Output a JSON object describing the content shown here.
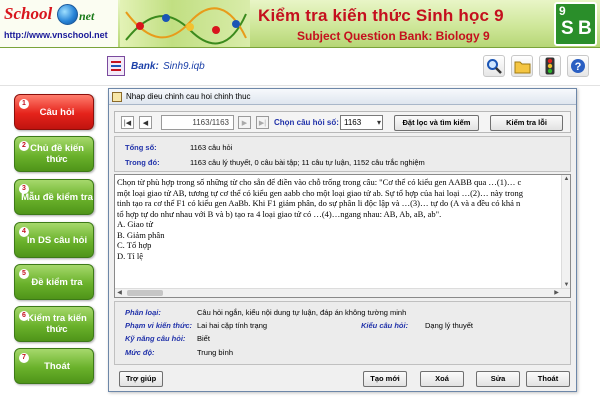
{
  "header": {
    "logo_school": "School",
    "logo_net": "net",
    "logo_url": "http://www.vnschool.net",
    "title_main": "Kiểm tra kiến thức Sinh học 9",
    "title_sub": "Subject Question Bank: Biology 9",
    "bio_logo": {
      "grade": "9",
      "letter_s": "S",
      "letter_b": "B"
    }
  },
  "toolbar": {
    "bank_label": "Bank:",
    "bank_file": "Sinh9.iqb",
    "buttons": [
      {
        "name": "search-icon",
        "glyph": "🔍"
      },
      {
        "name": "folder-icon",
        "glyph": "📂"
      },
      {
        "name": "traffic-light-icon",
        "glyph": "🚦"
      },
      {
        "name": "help-icon",
        "glyph": "?"
      }
    ]
  },
  "menu": [
    {
      "num": "1",
      "label": "Câu hỏi",
      "active": true
    },
    {
      "num": "2",
      "label": "Chủ đề kiến thức",
      "active": false
    },
    {
      "num": "3",
      "label": "Mẫu đề kiểm tra",
      "active": false
    },
    {
      "num": "4",
      "label": "In DS câu hỏi",
      "active": false
    },
    {
      "num": "5",
      "label": "Đề kiểm tra",
      "active": false
    },
    {
      "num": "6",
      "label": "Kiểm tra kiến thức",
      "active": false
    },
    {
      "num": "7",
      "label": "Thoát",
      "active": false
    }
  ],
  "dialog": {
    "title": "Nhap dieu chinh cau hoi chinh thuc",
    "nav": {
      "counter": "1163/1163",
      "chon_label": "Chọn câu hỏi số:",
      "chon_value": "1163",
      "filter_button": "Đặt lọc và tìm kiếm",
      "check_button": "Kiểm tra lỗi"
    },
    "info": {
      "tong_so_label": "Tổng số:",
      "tong_so_value": "1163 câu hỏi",
      "trong_do_label": "Trong đó:",
      "trong_do_value": "1163 câu lý thuyết, 0 câu bài tập; 11 câu tự luận, 1152 câu trắc nghiệm"
    },
    "question_lines": [
      "Chọn từ phù hợp trong số những từ cho sẵn để điền vào chỗ trống trong câu: \"Cơ thể có kiểu gen AABB qua …(1)… c",
      "một loại giao tử AB, tương tự cơ thể có kiểu gen aabb cho một loại giao tử ab. Sự tổ hợp của hai loại …(2)… này trong",
      "tinh tạo ra cơ thể F1 có kiểu gen AaBb. Khi F1 giảm phân, do sự phân li độc lập và …(3)… tự do (A và a đều có khả n",
      "tổ hợp tự do như nhau với B và b) tạo ra 4 loại giao tử có …(4)…ngang nhau: AB, Ab, aB, ab\"."
    ],
    "answers": [
      "A. Giao tử",
      "B. Giảm phân",
      "C. Tổ hợp",
      "D.  Tỉ lệ"
    ],
    "meta": {
      "phan_loai_label": "Phân loại:",
      "phan_loai_value": "Câu hỏi ngắn, kiểu nội dung tự luận, đáp án không tường minh",
      "pham_vi_label": "Phạm vi kiến thức:",
      "pham_vi_value": "Lai hai cặp tính trạng",
      "kieu_label": "Kiểu câu hỏi:",
      "kieu_value": "Dạng lý thuyết",
      "ky_nang_label": "Kỹ năng câu hỏi:",
      "ky_nang_value": "Biết",
      "muc_do_label": "Mức độ:",
      "muc_do_value": "Trung bình"
    },
    "buttons": {
      "help": "Trợ giúp",
      "new": "Tạo mới",
      "delete": "Xoá",
      "edit": "Sửa",
      "exit": "Thoát"
    }
  },
  "colors": {
    "accent_red": "#c4101e",
    "menu_green": "#6ab22b",
    "menu_active_red": "#e5231b",
    "label_blue": "#2233aa"
  }
}
